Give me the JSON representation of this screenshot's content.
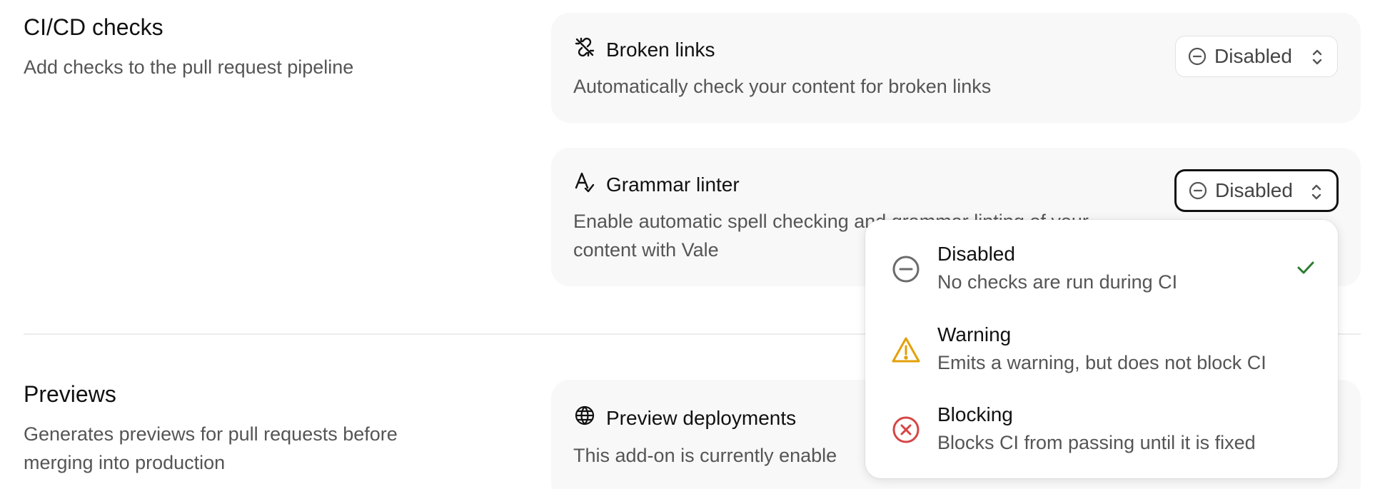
{
  "cicd": {
    "title": "CI/CD checks",
    "description": "Add checks to the pull request pipeline",
    "broken_links": {
      "title": "Broken links",
      "description": "Automatically check your content for broken links",
      "icon": "broken-link-icon",
      "status": "Disabled"
    },
    "grammar": {
      "title": "Grammar linter",
      "description_line1": "Enable automatic spell checking and grammar linting of your",
      "description_line2": "content with Vale",
      "icon": "spell-check-icon",
      "status": "Disabled"
    }
  },
  "previews": {
    "title": "Previews",
    "description_line1": "Generates previews for pull requests before",
    "description_line2": "merging into production",
    "deployments": {
      "title": "Preview deployments",
      "description": "This add-on is currently enable",
      "icon": "globe-icon"
    }
  },
  "dropdown": {
    "options": [
      {
        "label": "Disabled",
        "description": "No checks are run during CI",
        "icon": "minus-circle-icon",
        "color": "#6b6b6b",
        "selected": true
      },
      {
        "label": "Warning",
        "description": "Emits a warning, but does not block CI",
        "icon": "warning-triangle-icon",
        "color": "#e3a008"
      },
      {
        "label": "Blocking",
        "description": "Blocks CI from passing until it is fixed",
        "icon": "x-circle-icon",
        "color": "#d64545"
      }
    ],
    "check_color": "#2e7d32"
  }
}
